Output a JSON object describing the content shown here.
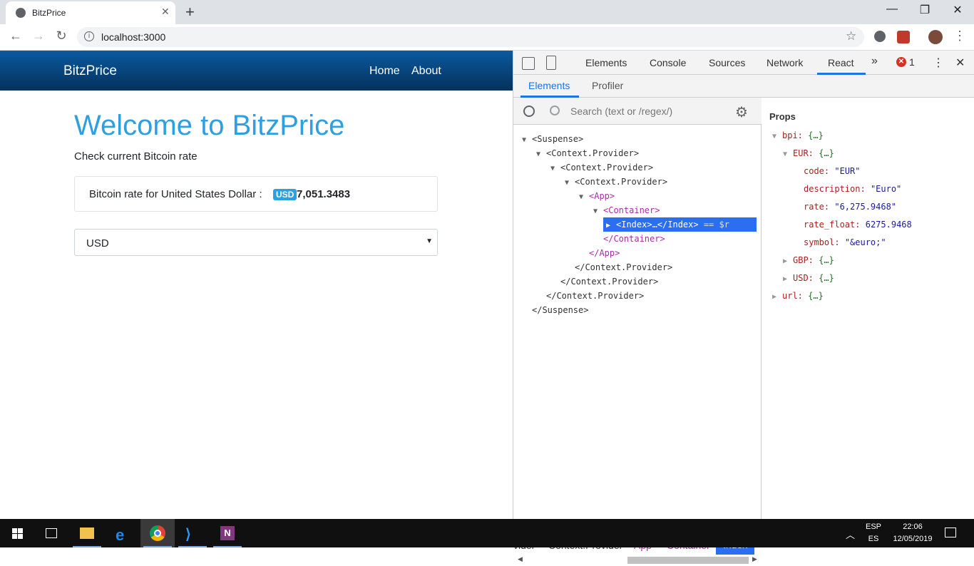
{
  "browser": {
    "tab_title": "BitzPrice",
    "tab_close": "✕",
    "new_tab": "+",
    "url": "localhost:3000",
    "window_controls": {
      "minimize": "—",
      "maximize": "❐",
      "close": "✕"
    }
  },
  "page": {
    "brand": "BitzPrice",
    "nav": {
      "home": "Home",
      "about": "About"
    },
    "heading": "Welcome to BitzPrice",
    "subtitle": "Check current Bitcoin rate",
    "rate_label": "Bitcoin rate for United States Dollar :",
    "rate_badge": "USD",
    "rate_value": "7,051.3483",
    "currency_selected": "USD",
    "colors": {
      "navbar": "#0a5aa0",
      "heading": "#2e9fe0"
    }
  },
  "devtools": {
    "tabs": {
      "elements": "Elements",
      "console": "Console",
      "sources": "Sources",
      "network": "Network",
      "react": "React",
      "more": "»"
    },
    "error_count": "1",
    "subtabs": {
      "elements": "Elements",
      "profiler": "Profiler"
    },
    "search_placeholder": "Search (text or /regex/)",
    "tree": [
      {
        "label": "<Suspense>",
        "indent": 0
      },
      {
        "label": "<Context.Provider>",
        "indent": 1
      },
      {
        "label": "<Context.Provider>",
        "indent": 2
      },
      {
        "label": "<Context.Provider>",
        "indent": 3
      },
      {
        "label": "<App>",
        "indent": 4
      },
      {
        "label": "<Container>",
        "indent": 5
      },
      {
        "label": "<Index>…</Index>",
        "indent": 6,
        "suffix": "== $r"
      },
      {
        "label": "</Container>",
        "indent": 5
      },
      {
        "label": "</App>",
        "indent": 4
      },
      {
        "label": "</Context.Provider>",
        "indent": 3
      },
      {
        "label": "</Context.Provider>",
        "indent": 2
      },
      {
        "label": "</Context.Provider>",
        "indent": 1
      },
      {
        "label": "</Suspense>",
        "indent": 0
      }
    ],
    "breadcrumbs": [
      "vider",
      "Context.Provider",
      "App",
      "Container",
      "Index"
    ],
    "props": {
      "title": "Props",
      "bpi_key": "bpi:",
      "bpi_val": "{…}",
      "eur_key": "EUR:",
      "eur_val": "{…}",
      "code_key": "code:",
      "code_val": "\"EUR\"",
      "description_key": "description:",
      "description_val": "\"Euro\"",
      "rate_key": "rate:",
      "rate_val": "\"6,275.9468\"",
      "rate_float_key": "rate_float:",
      "rate_float_val": "6275.9468",
      "symbol_key": "symbol:",
      "symbol_val": "\"&euro;\"",
      "gbp_key": "GBP:",
      "gbp_val": "{…}",
      "usd_key": "USD:",
      "usd_val": "{…}",
      "url_key": "url:",
      "url_val": "{…}"
    }
  },
  "taskbar": {
    "lang_top": "ESP",
    "lang_bottom": "ES",
    "time": "22:06",
    "date": "12/05/2019"
  }
}
